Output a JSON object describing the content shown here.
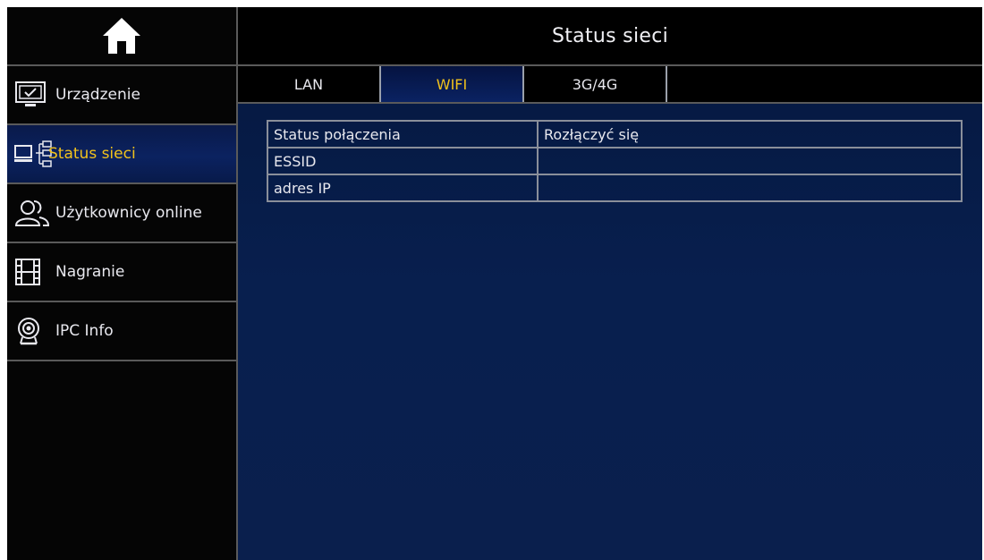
{
  "header": {
    "title": "Status sieci"
  },
  "home": {
    "icon": "home-icon"
  },
  "sidebar": {
    "items": [
      {
        "label": "Urządzenie",
        "icon": "monitor-icon",
        "active": false
      },
      {
        "label": "Status sieci",
        "icon": "network-icon",
        "active": true
      },
      {
        "label": "Użytkownicy online",
        "icon": "users-icon",
        "active": false
      },
      {
        "label": "Nagranie",
        "icon": "film-icon",
        "active": false
      },
      {
        "label": "IPC Info",
        "icon": "camera-icon",
        "active": false
      }
    ]
  },
  "tabs": [
    {
      "label": "LAN",
      "active": false
    },
    {
      "label": "WIFI",
      "active": true
    },
    {
      "label": "3G/4G",
      "active": false
    }
  ],
  "status_table": {
    "rows": [
      {
        "label": "Status połączenia",
        "value": "Rozłączyć się"
      },
      {
        "label": "ESSID",
        "value": ""
      },
      {
        "label": "adres IP",
        "value": ""
      }
    ]
  },
  "colors": {
    "accent": "#f1c21c",
    "panel_bg": "#0a1f4d",
    "border": "#5a5a5a"
  }
}
